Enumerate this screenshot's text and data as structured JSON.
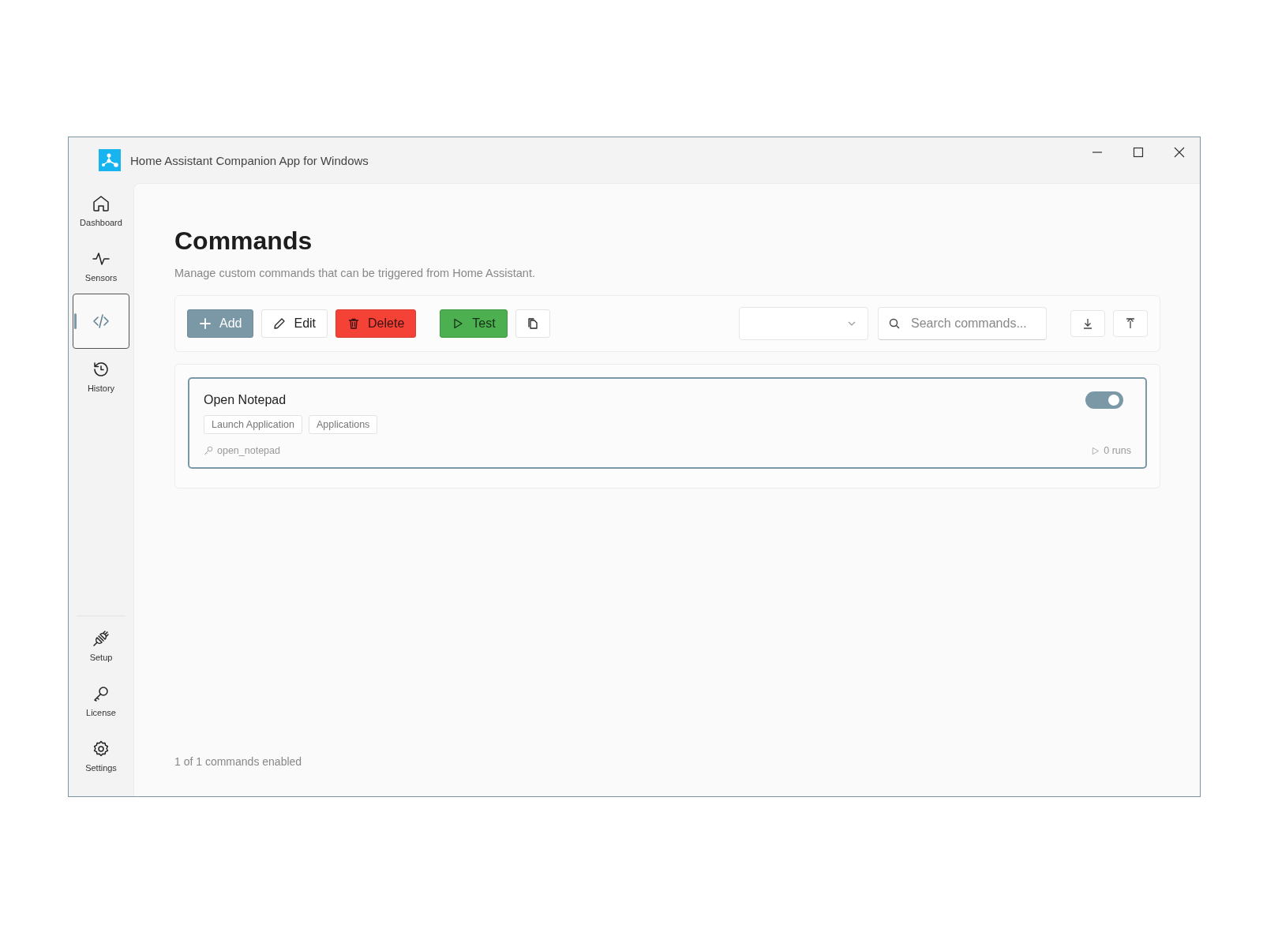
{
  "window": {
    "title": "Home Assistant Companion App for Windows"
  },
  "sidebar": {
    "items": [
      {
        "label": "Dashboard",
        "selected": false
      },
      {
        "label": "Sensors",
        "selected": false
      },
      {
        "selected": true
      },
      {
        "label": "History",
        "selected": false
      }
    ],
    "bottom_items": [
      {
        "label": "Setup",
        "selected": false
      },
      {
        "label": "License",
        "selected": false
      },
      {
        "label": "Settings",
        "selected": false
      }
    ]
  },
  "page": {
    "title": "Commands",
    "subtitle": "Manage custom commands that can be triggered from Home Assistant."
  },
  "toolbar": {
    "buttons": [
      {
        "kind": "add",
        "label": "Add"
      },
      {
        "kind": "edit",
        "label": "Edit"
      },
      {
        "kind": "delete",
        "label": "Delete"
      },
      {
        "kind": "test",
        "label": "Test"
      },
      {
        "kind": "copy"
      }
    ],
    "search": {
      "placeholder": "Search commands..."
    }
  },
  "commands": [
    {
      "name": "Open Notepad",
      "tags": [
        "Launch Application",
        "Applications"
      ],
      "id": "open_notepad",
      "runs": "0 runs",
      "enabled": true,
      "selected": true
    }
  ],
  "status_bar": "1 of 1 commands enabled"
}
